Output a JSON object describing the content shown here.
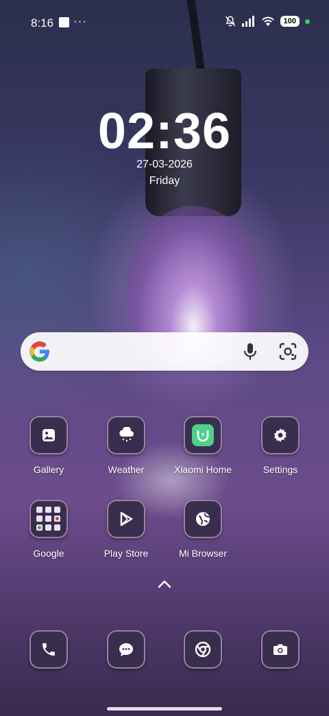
{
  "status_bar": {
    "time": "8:16",
    "dots": "···",
    "battery": "100"
  },
  "clock": {
    "time": "02:36",
    "date": "27-03-2026",
    "day": "Friday"
  },
  "search": {
    "icons": [
      "google-g-icon",
      "mic-icon",
      "lens-icon"
    ]
  },
  "apps": [
    {
      "label": "Gallery",
      "icon": "gallery-icon"
    },
    {
      "label": "Weather",
      "icon": "weather-icon"
    },
    {
      "label": "Xiaomi Home",
      "icon": "xiaomi-home-icon"
    },
    {
      "label": "Settings",
      "icon": "gear-icon"
    },
    {
      "label": "Google",
      "icon": "google-folder-icon"
    },
    {
      "label": "Play Store",
      "icon": "play-store-icon"
    },
    {
      "label": "Mi Browser",
      "icon": "globe-icon"
    }
  ],
  "dock": [
    "phone-icon",
    "messages-icon",
    "chrome-icon",
    "camera-icon"
  ],
  "colors": {
    "accent_green": "#3ad06b",
    "icon_bg": "#3a2e4f",
    "xiaomi_green": "#4fd18a"
  }
}
